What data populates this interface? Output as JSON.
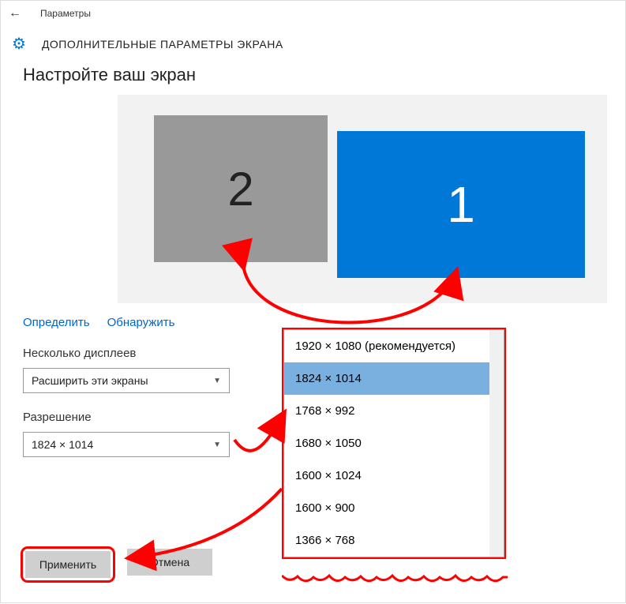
{
  "titlebar": {
    "text": "Параметры"
  },
  "header": {
    "title": "ДОПОЛНИТЕЛЬНЫЕ ПАРАМЕТРЫ ЭКРАНА"
  },
  "page": {
    "heading": "Настройте ваш экран"
  },
  "monitors": {
    "label1": "1",
    "label2": "2"
  },
  "links": {
    "identify": "Определить",
    "detect": "Обнаружить"
  },
  "multiDisplays": {
    "label": "Несколько дисплеев",
    "value": "Расширить эти экраны"
  },
  "resolution": {
    "label": "Разрешение",
    "value": "1824 × 1014",
    "options": [
      "1920 × 1080 (рекомендуется)",
      "1824 × 1014",
      "1768 × 992",
      "1680 × 1050",
      "1600 × 1024",
      "1600 × 900",
      "1366 × 768"
    ],
    "selectedIndex": 1
  },
  "buttons": {
    "apply": "Применить",
    "cancel": "Отмена"
  }
}
